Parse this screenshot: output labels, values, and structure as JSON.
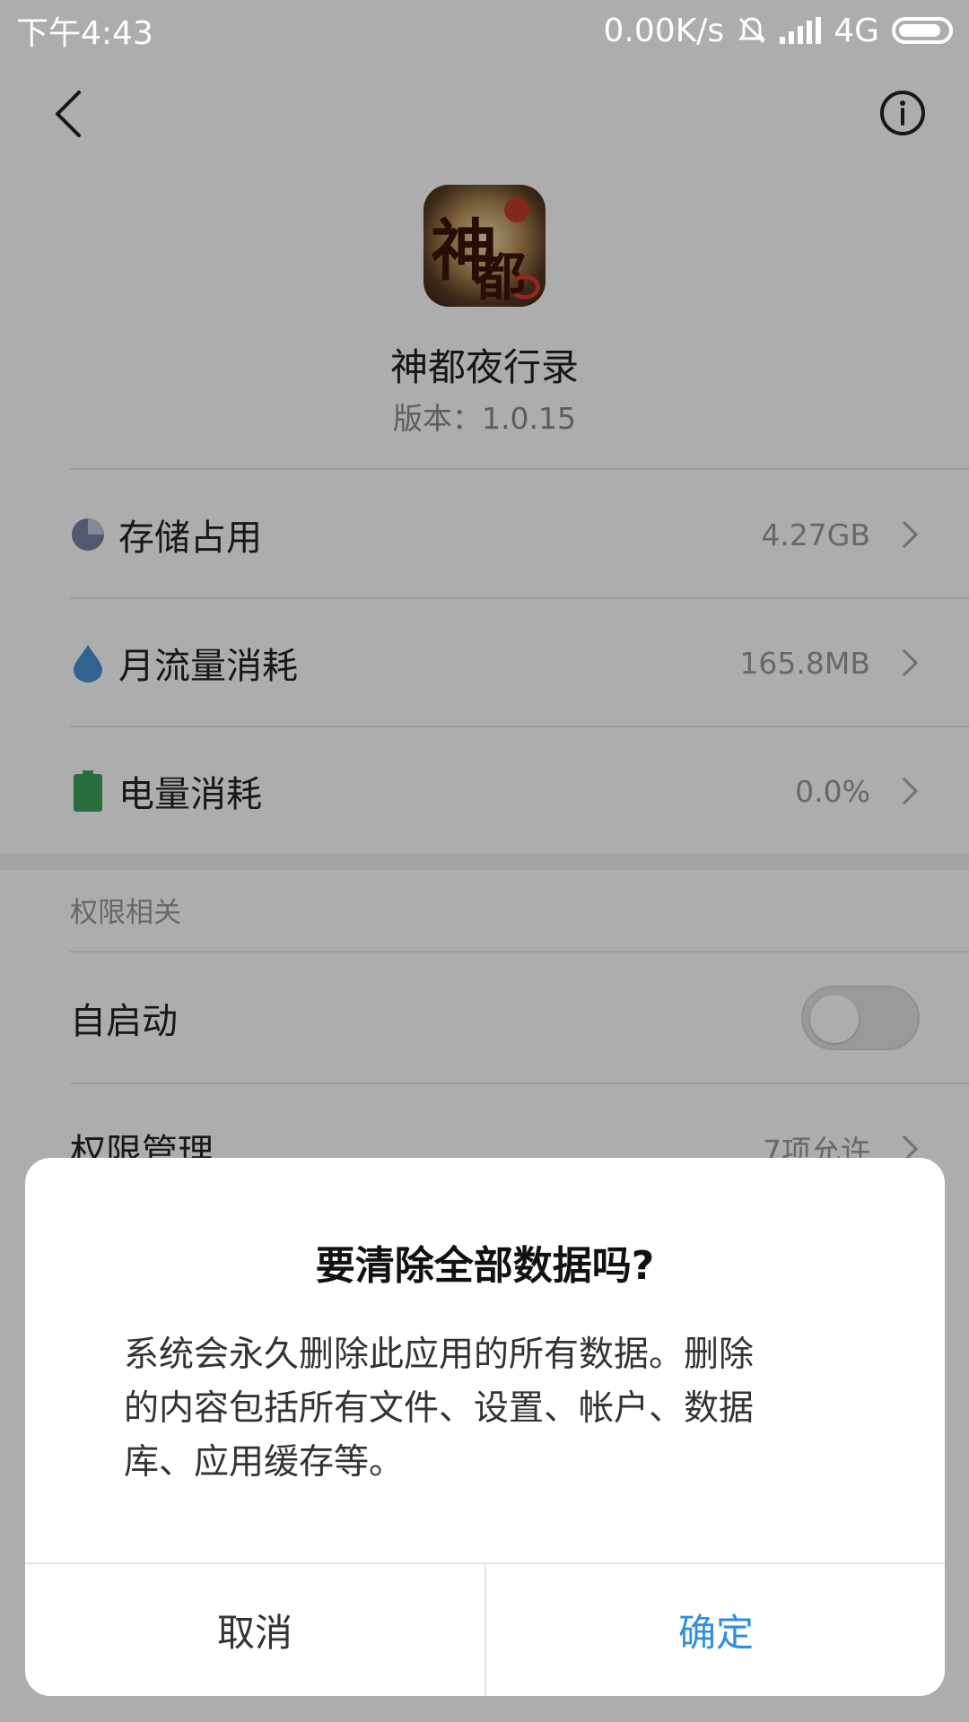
{
  "status_bar": {
    "time": "下午4:43",
    "net_speed": "0.00K/s",
    "network": "4G"
  },
  "header": {
    "back_icon": "chevron-left-icon",
    "info_icon": "info-circle-icon"
  },
  "app": {
    "name": "神都夜行录",
    "version": "版本：1.0.15",
    "icon_glyph_1": "神",
    "icon_glyph_2": "都"
  },
  "usage_rows": [
    {
      "label": "存储占用",
      "value": "4.27GB",
      "icon": "pie-chart-icon",
      "color": "#7a82a6"
    },
    {
      "label": "月流量消耗",
      "value": "165.8MB",
      "icon": "water-drop-icon",
      "color": "#4b93d4"
    },
    {
      "label": "电量消耗",
      "value": "0.0%",
      "icon": "battery-icon",
      "color": "#3fa35f"
    }
  ],
  "permissions": {
    "section_title": "权限相关",
    "autostart_label": "自启动",
    "autostart_enabled": false,
    "manage_label": "权限管理",
    "manage_value": "7项允许"
  },
  "dialog": {
    "title": "要清除全部数据吗?",
    "message_lines": [
      "系统会永久删除此应用的所有数据。删除",
      "的内容包括所有文件、设置、帐户、数据",
      "库、应用缓存等。"
    ],
    "cancel_label": "取消",
    "confirm_label": "确定",
    "confirm_color": "#2e8fe0"
  }
}
